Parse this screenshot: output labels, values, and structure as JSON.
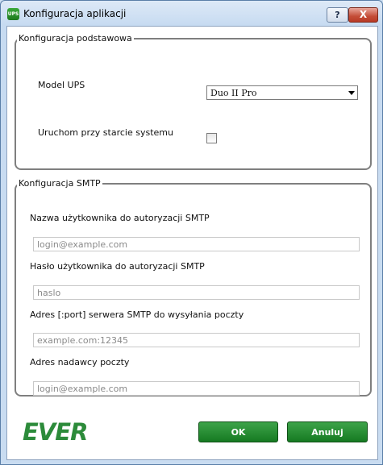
{
  "window": {
    "title": "Konfiguracja aplikacji",
    "icon_text": "UPS",
    "help_label": "?",
    "close_label": "X"
  },
  "basic": {
    "legend": "Konfiguracja podstawowa",
    "model_label": "Model UPS",
    "model_value": "Duo II Pro",
    "startup_label": "Uruchom przy starcie systemu",
    "startup_checked": false
  },
  "smtp": {
    "legend": "Konfiguracja SMTP",
    "user_label": "Nazwa użytkownika do autoryzacji SMTP",
    "user_placeholder": "login@example.com",
    "password_label": "Hasło użytkownika do autoryzacji SMTP",
    "password_placeholder": "haslo",
    "server_label": "Adres [:port] serwera SMTP do wysyłania poczty",
    "server_placeholder": "example.com:12345",
    "sender_label": "Adres nadawcy poczty",
    "sender_placeholder": "login@example.com"
  },
  "footer": {
    "logo": "EVER",
    "ok_label": "OK",
    "cancel_label": "Anuluj"
  },
  "colors": {
    "accent": "#1e8a2c",
    "logo": "#2c8b3a"
  }
}
